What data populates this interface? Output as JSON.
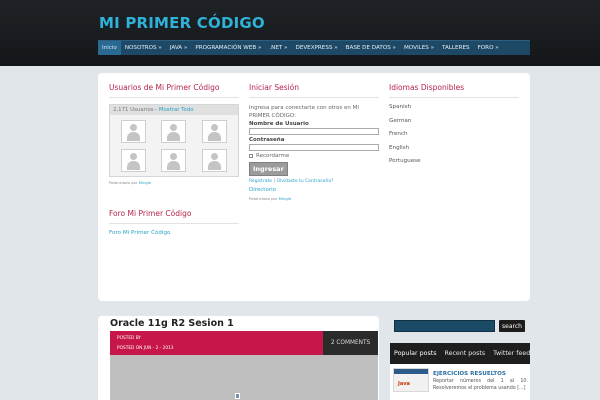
{
  "site": {
    "title": "MI PRIMER CÓDIGO"
  },
  "nav": {
    "items": [
      {
        "label": "Inicio"
      },
      {
        "label": "NOSOTROS »"
      },
      {
        "label": "JAVA »"
      },
      {
        "label": "PROGRAMACIÓN WEB »"
      },
      {
        "label": ".NET »"
      },
      {
        "label": "DEVEXPRESS »"
      },
      {
        "label": "BASE DE DATOS »"
      },
      {
        "label": "MOVILES »"
      },
      {
        "label": "TALLERES"
      },
      {
        "label": "FORO »"
      }
    ]
  },
  "users_widget": {
    "title": "Usuarios de Mi Primer Código",
    "count": "2,171 Usuarios",
    "separator": "-",
    "show_all": "Mostrar Todo",
    "powered_by": "Potenciado por",
    "powered_name": "Mingle"
  },
  "forum_widget": {
    "title": "Foro Mi Primer Código",
    "link": "Foro Mi Primer Código"
  },
  "login_widget": {
    "title": "Iniciar Sesión",
    "description": "Ingresa para conectarte con otros en MI PRIMER CÓDIGO:",
    "username_label": "Nombre de Usuario",
    "password_label": "Contraseña",
    "remember_label": "Recordarme",
    "submit_label": "Ingresar",
    "register_link": "Registrate",
    "link_separator": "|",
    "forgot_link": "Olvidaste tu Contraseña?",
    "directory_link": "Directorio",
    "powered_by": "Potenciado por",
    "powered_name": "Mingle"
  },
  "languages_widget": {
    "title": "Idiomas Disponibles",
    "items": [
      "Spanish",
      "German",
      "French",
      "English",
      "Portuguese"
    ]
  },
  "post": {
    "title": "Oracle 11g R2 Sesion 1",
    "posted_by": "POSTED BY",
    "posted_on": "POSTED ON JUN - 2 - 2013",
    "comments": "2 COMMENTS"
  },
  "sidebar": {
    "search_button": "search",
    "tabs": [
      "Popular posts",
      "Recent posts",
      "Twitter feed"
    ],
    "popular": [
      {
        "thumb_label": "Java",
        "title": "EJERCICIOS RESUELTOS",
        "excerpt": "Reportar números del 1 al 10. Resolveremos el problema usando [...]"
      }
    ]
  },
  "colors": {
    "header_bg": "#1a1d20",
    "title": "#2fb2d8",
    "nav_bg": "#1d4966",
    "widget_title": "#b5244a",
    "post_meta_bg": "#c7174a"
  }
}
